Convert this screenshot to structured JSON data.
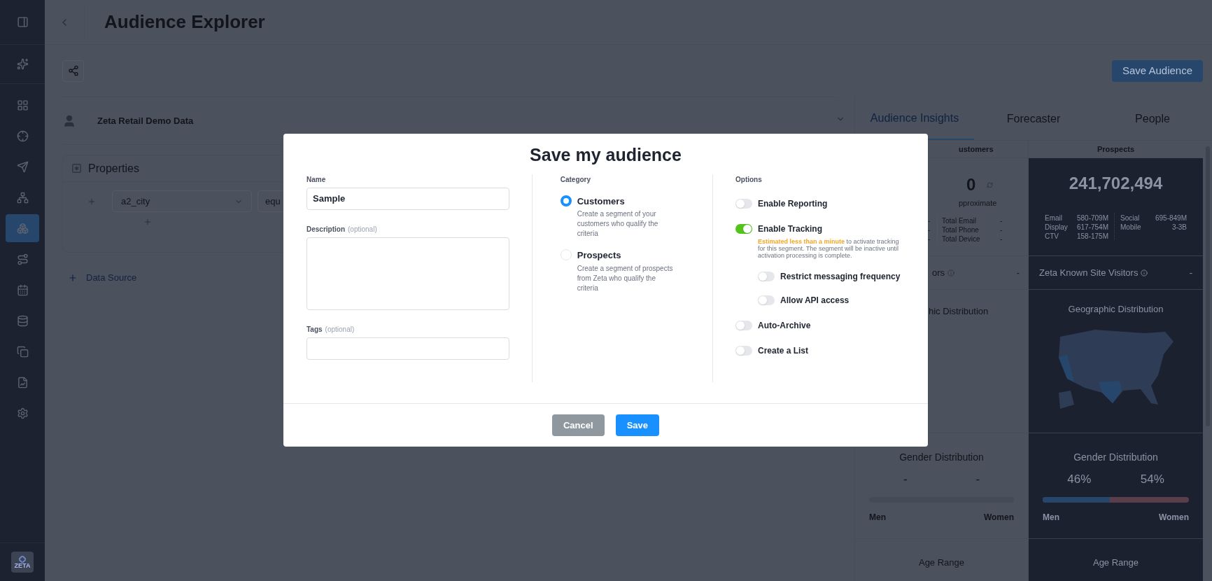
{
  "sidebar": {
    "items": [
      {
        "selected": false
      },
      {
        "selected": false
      },
      {
        "selected": false
      },
      {
        "selected": false
      },
      {
        "selected": false
      },
      {
        "selected": false
      },
      {
        "selected": true
      },
      {
        "selected": false
      },
      {
        "selected": false
      },
      {
        "selected": false
      },
      {
        "selected": false
      },
      {
        "selected": false
      },
      {
        "selected": false
      }
    ],
    "logo": "ZETA"
  },
  "header": {
    "title": "Audience Explorer"
  },
  "toolbar": {
    "save_button": "Save Audience"
  },
  "data_source": {
    "name": "Zeta Retail Demo Data"
  },
  "properties": {
    "title": "Properties",
    "field": "a2_city",
    "operator": "equ",
    "add_link": "Data Source"
  },
  "insights": {
    "tabs": [
      {
        "label": "Audience Insights",
        "selected": true
      },
      {
        "label": "Forecaster",
        "selected": false
      },
      {
        "label": "People",
        "selected": false
      }
    ],
    "customers": {
      "heading": "ustomers",
      "count": "0",
      "note": "pproximate",
      "rows": [
        {
          "value": "-",
          "label": "Total Email",
          "total": "-"
        },
        {
          "value": "-",
          "label": "Total Phone",
          "total": "-"
        },
        {
          "value": "-",
          "label": "Total Device",
          "total": "-"
        }
      ],
      "visitors": {
        "label": "ors",
        "value": "-"
      },
      "geo_title": "hic Distribution",
      "gender": {
        "title": "Gender Distribution",
        "men_value": "-",
        "women_value": "-",
        "men": "Men",
        "women": "Women"
      },
      "age_title": "Age Range"
    },
    "prospects": {
      "heading": "Prospects",
      "count": "241,702,494",
      "channels": [
        {
          "name": "Email",
          "range": "580-709M"
        },
        {
          "name": "Display",
          "range": "617-754M"
        },
        {
          "name": "CTV",
          "range": "158-175M"
        },
        {
          "name": "Social",
          "range": "695-849M"
        },
        {
          "name": "Mobile",
          "range": "3-3B"
        }
      ],
      "visitors": {
        "label": "Zeta Known Site Visitors",
        "value": "-"
      },
      "geo_title": "Geographic Distribution",
      "gender": {
        "title": "Gender Distribution",
        "men_value": "46%",
        "women_value": "54%",
        "men": "Men",
        "women": "Women",
        "level": 0.46
      },
      "age_title": "Age Range"
    }
  },
  "modal": {
    "title": "Save my audience",
    "name": {
      "label": "Name",
      "value": "Sample"
    },
    "description": {
      "label": "Description",
      "hint": "(optional)"
    },
    "tags": {
      "label": "Tags",
      "hint": "(optional)"
    },
    "category": {
      "label": "Category",
      "options": [
        {
          "label": "Customers",
          "description": "Create a segment of your customers who qualify the criteria",
          "selected": true
        },
        {
          "label": "Prospects",
          "description": "Create a segment of prospects from Zeta who qualify the criteria",
          "selected": false
        }
      ]
    },
    "options": {
      "label": "Options",
      "items": [
        {
          "label": "Enable Reporting",
          "on": false
        },
        {
          "label": "Enable Tracking",
          "on": true,
          "note_highlight": "Estimated less than a minute",
          "note": "to activate tracking for this segment. The segment will be inactive until activation processing is complete.",
          "children": [
            {
              "label": "Restrict messaging frequency",
              "on": false
            },
            {
              "label": "Allow API access",
              "on": false
            }
          ]
        },
        {
          "label": "Auto-Archive",
          "on": false
        },
        {
          "label": "Create a List",
          "on": false
        }
      ]
    },
    "buttons": {
      "cancel": "Cancel",
      "save": "Save"
    }
  }
}
